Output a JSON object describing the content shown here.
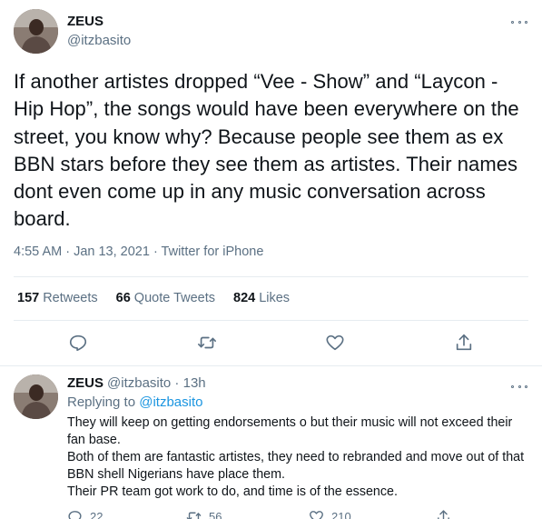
{
  "main_tweet": {
    "author_name": "ZEUS",
    "handle": "@itzbasito",
    "text": "If another artistes dropped “Vee - Show” and “Laycon - Hip Hop”, the songs would have been everywhere on the street, you know why? Because people see them as ex BBN stars before they see them as artistes. Their names dont even come up in any music conversation across board.",
    "timestamp": "4:55 AM · Jan 13, 2021 · Twitter for iPhone",
    "stats": {
      "retweets_count": "157",
      "retweets_label": "Retweets",
      "quote_count": "66",
      "quote_label": "Quote Tweets",
      "likes_count": "824",
      "likes_label": "Likes"
    },
    "actions": [
      "reply-icon",
      "retweet-icon",
      "like-icon",
      "share-icon"
    ]
  },
  "reply_tweet": {
    "author_name": "ZEUS",
    "handle_time": "@itzbasito · 13h",
    "replying_prefix": "Replying to",
    "replying_to": "@itzbasito",
    "lines": [
      "They will keep on getting endorsements o but their music will not exceed their fan base.",
      "Both of them are fantastic artistes, they need to rebranded and move out of that BBN shell Nigerians have place them.",
      "Their PR team got work to do, and time is of the essence."
    ],
    "reply_count": "22",
    "retweet_count": "56",
    "like_count": "210"
  },
  "colors": {
    "text": "#0f1419",
    "secondary": "#5b7083",
    "link": "#1b95e0",
    "divider": "#e6ecf0"
  }
}
